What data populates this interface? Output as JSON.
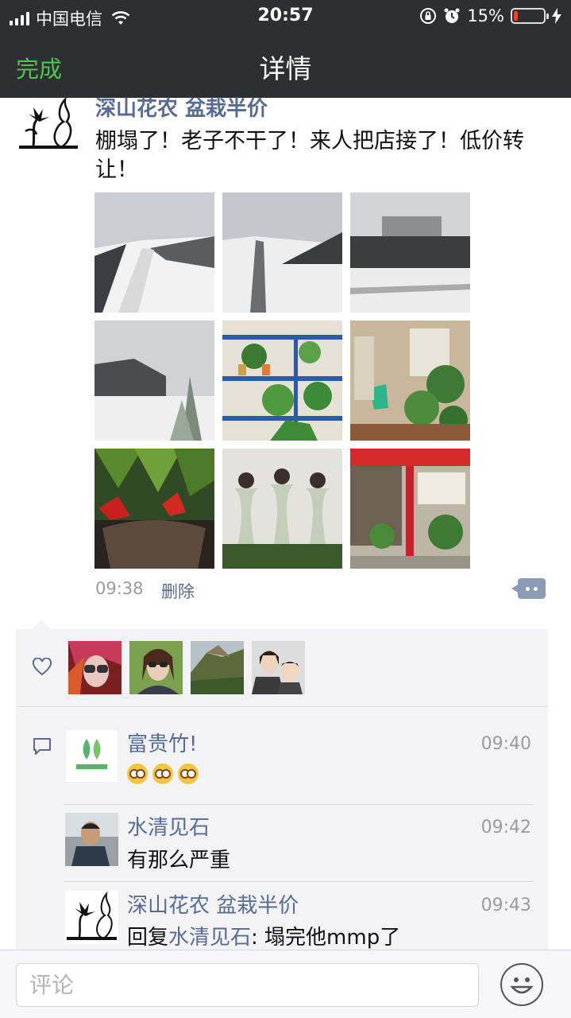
{
  "status_bar": {
    "carrier": "中国电信",
    "time": "20:57",
    "battery_text": "15%",
    "battery_level": 0.15,
    "battery_color": "#ff3b30"
  },
  "nav": {
    "back_label": "完成",
    "title": "详情"
  },
  "post": {
    "author": "深山花农 盆栽半价",
    "text": "棚塌了！老子不干了！来人把店接了！低价转让！",
    "image_count": 9,
    "time": "09:38",
    "delete_label": "删除"
  },
  "likes": {
    "icon": "heart-icon",
    "count": 4
  },
  "comments": [
    {
      "name": "富贵竹!",
      "time": "09:40",
      "text": "",
      "emoji_count": 3
    },
    {
      "name": "水清见石",
      "time": "09:42",
      "text": "有那么严重"
    },
    {
      "name": "深山花农 盆栽半价",
      "time": "09:43",
      "reply_prefix": "回复",
      "reply_to": "水清见石",
      "text": ": 塌完他mmp了"
    }
  ],
  "comment_bar": {
    "placeholder": "评论"
  },
  "colors": {
    "accent_green": "#4cc552",
    "link_blue": "#576b95",
    "nav_bg": "#2e2f31"
  }
}
